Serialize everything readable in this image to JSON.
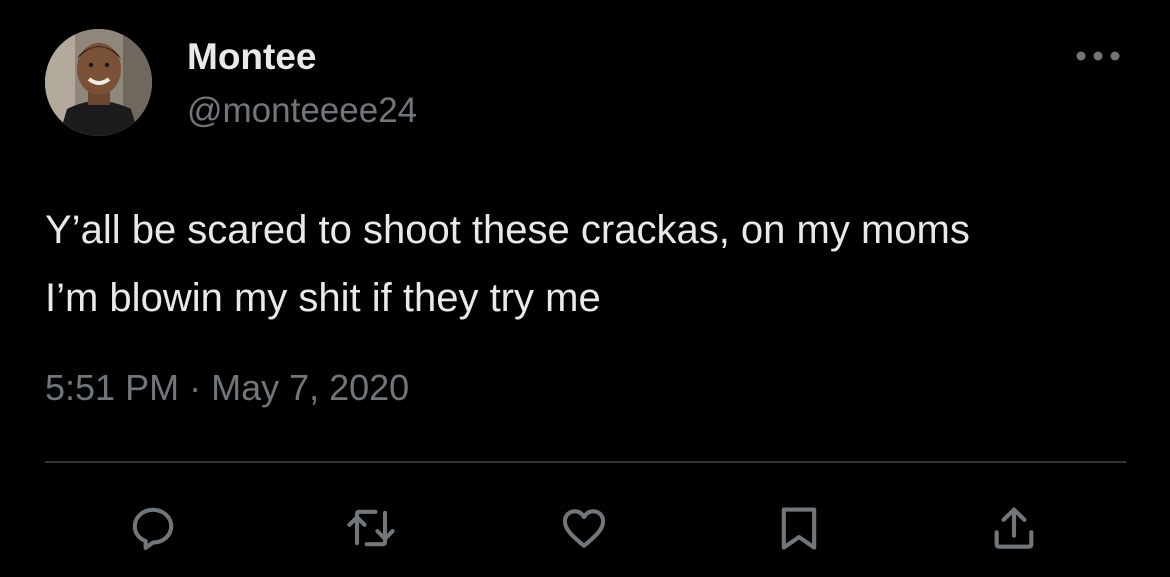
{
  "author": {
    "display_name": "Montee",
    "handle": "@monteeee24"
  },
  "tweet": {
    "lines": [
      "Y’all be scared to shoot these crackas, on my moms",
      "I’m blowin my shit if they try me"
    ],
    "time": "5:51 PM",
    "separator": " · ",
    "date": "May 7, 2020"
  },
  "actions": {
    "icons": [
      "reply-icon",
      "retweet-icon",
      "like-icon",
      "bookmark-icon",
      "share-icon"
    ]
  },
  "colors": {
    "background": "#000000",
    "primary_text": "#e7e9ea",
    "secondary_text": "#71767b",
    "divider": "#2f3336"
  }
}
